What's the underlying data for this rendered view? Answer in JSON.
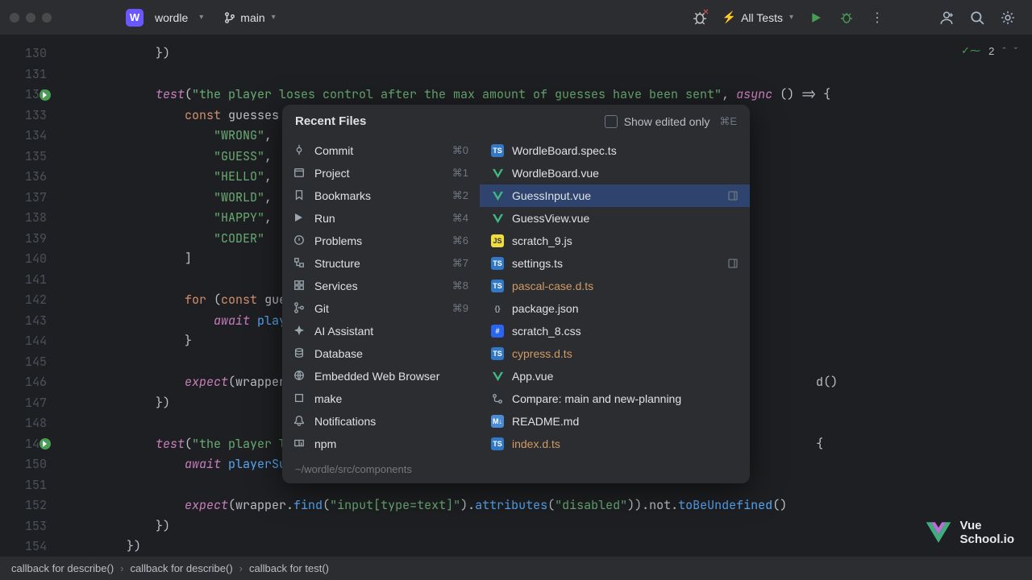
{
  "titlebar": {
    "project_badge": "W",
    "project_name": "wordle",
    "branch": "main",
    "run_config": "All Tests"
  },
  "inspections": {
    "count": "2"
  },
  "gutter": {
    "start": 130,
    "end": 154,
    "run_markers": [
      132,
      149
    ]
  },
  "code_lines": [
    {
      "n": 130,
      "segs": [
        {
          "t": "            })",
          "c": "op"
        }
      ]
    },
    {
      "n": 131,
      "segs": []
    },
    {
      "n": 132,
      "segs": [
        {
          "t": "            ",
          "c": "op"
        },
        {
          "t": "test",
          "c": "fn"
        },
        {
          "t": "(",
          "c": "op"
        },
        {
          "t": "\"the player loses control after the max amount of guesses have been sent\"",
          "c": "str"
        },
        {
          "t": ", ",
          "c": "op"
        },
        {
          "t": "async",
          "c": "fn"
        },
        {
          "t": " () ",
          "c": "op"
        },
        {
          "t": "=>",
          "c": "op"
        },
        {
          "t": " {",
          "c": "op"
        }
      ]
    },
    {
      "n": 133,
      "segs": [
        {
          "t": "                ",
          "c": "op"
        },
        {
          "t": "const",
          "c": "kw"
        },
        {
          "t": " guesses = ",
          "c": "op"
        }
      ]
    },
    {
      "n": 134,
      "segs": [
        {
          "t": "                    ",
          "c": "op"
        },
        {
          "t": "\"WRONG\"",
          "c": "str"
        },
        {
          "t": ",",
          "c": "op"
        }
      ]
    },
    {
      "n": 135,
      "segs": [
        {
          "t": "                    ",
          "c": "op"
        },
        {
          "t": "\"GUESS\"",
          "c": "str"
        },
        {
          "t": ",",
          "c": "op"
        }
      ]
    },
    {
      "n": 136,
      "segs": [
        {
          "t": "                    ",
          "c": "op"
        },
        {
          "t": "\"HELLO\"",
          "c": "str"
        },
        {
          "t": ",",
          "c": "op"
        }
      ]
    },
    {
      "n": 137,
      "segs": [
        {
          "t": "                    ",
          "c": "op"
        },
        {
          "t": "\"WORLD\"",
          "c": "str"
        },
        {
          "t": ",",
          "c": "op"
        }
      ]
    },
    {
      "n": 138,
      "segs": [
        {
          "t": "                    ",
          "c": "op"
        },
        {
          "t": "\"HAPPY\"",
          "c": "str"
        },
        {
          "t": ",",
          "c": "op"
        }
      ]
    },
    {
      "n": 139,
      "segs": [
        {
          "t": "                    ",
          "c": "op"
        },
        {
          "t": "\"CODER\"",
          "c": "str"
        }
      ]
    },
    {
      "n": 140,
      "segs": [
        {
          "t": "                ]",
          "c": "op"
        }
      ]
    },
    {
      "n": 141,
      "segs": []
    },
    {
      "n": 142,
      "segs": [
        {
          "t": "                ",
          "c": "op"
        },
        {
          "t": "for",
          "c": "kw"
        },
        {
          "t": " (",
          "c": "op"
        },
        {
          "t": "const",
          "c": "kw"
        },
        {
          "t": " guess",
          "c": "op"
        }
      ]
    },
    {
      "n": 143,
      "segs": [
        {
          "t": "                    ",
          "c": "op"
        },
        {
          "t": "await",
          "c": "fn"
        },
        {
          "t": " ",
          "c": "op"
        },
        {
          "t": "player",
          "c": "meth"
        }
      ]
    },
    {
      "n": 144,
      "segs": [
        {
          "t": "                }",
          "c": "op"
        }
      ]
    },
    {
      "n": 145,
      "segs": []
    },
    {
      "n": 146,
      "segs": [
        {
          "t": "                ",
          "c": "op"
        },
        {
          "t": "expect",
          "c": "fn"
        },
        {
          "t": "(wrapper.f",
          "c": "op"
        },
        {
          "t": "                                                                       d",
          "c": "op"
        },
        {
          "t": "()",
          "c": "op"
        }
      ]
    },
    {
      "n": 147,
      "segs": [
        {
          "t": "            })",
          "c": "op"
        }
      ]
    },
    {
      "n": 148,
      "segs": []
    },
    {
      "n": 149,
      "segs": [
        {
          "t": "            ",
          "c": "op"
        },
        {
          "t": "test",
          "c": "fn"
        },
        {
          "t": "(",
          "c": "op"
        },
        {
          "t": "\"the player los",
          "c": "str"
        },
        {
          "t": "                                                                       ",
          "c": "op"
        },
        {
          "t": "{",
          "c": "op"
        }
      ]
    },
    {
      "n": 150,
      "segs": [
        {
          "t": "                ",
          "c": "op"
        },
        {
          "t": "await",
          "c": "fn"
        },
        {
          "t": " ",
          "c": "op"
        },
        {
          "t": "playerSubm",
          "c": "meth"
        }
      ]
    },
    {
      "n": 151,
      "segs": []
    },
    {
      "n": 152,
      "segs": [
        {
          "t": "                ",
          "c": "op"
        },
        {
          "t": "expect",
          "c": "fn"
        },
        {
          "t": "(wrapper.",
          "c": "op"
        },
        {
          "t": "find",
          "c": "meth"
        },
        {
          "t": "(",
          "c": "op"
        },
        {
          "t": "\"input[type=text]\"",
          "c": "str"
        },
        {
          "t": ").",
          "c": "op"
        },
        {
          "t": "attributes",
          "c": "meth"
        },
        {
          "t": "(",
          "c": "op"
        },
        {
          "t": "\"disabled\"",
          "c": "str"
        },
        {
          "t": ")).not.",
          "c": "op"
        },
        {
          "t": "toBeUndefined",
          "c": "meth"
        },
        {
          "t": "()",
          "c": "op"
        }
      ]
    },
    {
      "n": 153,
      "segs": [
        {
          "t": "            })",
          "c": "op"
        }
      ]
    },
    {
      "n": 154,
      "segs": [
        {
          "t": "        })",
          "c": "op"
        }
      ]
    }
  ],
  "popup": {
    "title": "Recent Files",
    "show_edited_label": "Show edited only",
    "show_edited_shortcut": "⌘E",
    "path": "~/wordle/src/components",
    "left": [
      {
        "icon": "commit",
        "label": "Commit",
        "sc": "⌘0"
      },
      {
        "icon": "project",
        "label": "Project",
        "sc": "⌘1"
      },
      {
        "icon": "bookmark",
        "label": "Bookmarks",
        "sc": "⌘2"
      },
      {
        "icon": "run",
        "label": "Run",
        "sc": "⌘4"
      },
      {
        "icon": "problems",
        "label": "Problems",
        "sc": "⌘6"
      },
      {
        "icon": "structure",
        "label": "Structure",
        "sc": "⌘7"
      },
      {
        "icon": "services",
        "label": "Services",
        "sc": "⌘8"
      },
      {
        "icon": "git",
        "label": "Git",
        "sc": "⌘9"
      },
      {
        "icon": "ai",
        "label": "AI Assistant",
        "sc": ""
      },
      {
        "icon": "db",
        "label": "Database",
        "sc": ""
      },
      {
        "icon": "browser",
        "label": "Embedded Web Browser",
        "sc": ""
      },
      {
        "icon": "make",
        "label": "make",
        "sc": ""
      },
      {
        "icon": "notif",
        "label": "Notifications",
        "sc": ""
      },
      {
        "icon": "npm",
        "label": "npm",
        "sc": ""
      }
    ],
    "right": [
      {
        "type": "ts",
        "label": "WordleBoard.spec.ts",
        "selected": false,
        "pin": false,
        "dirty": false
      },
      {
        "type": "vue",
        "label": "WordleBoard.vue",
        "selected": false,
        "pin": false,
        "dirty": false
      },
      {
        "type": "vue",
        "label": "GuessInput.vue",
        "selected": true,
        "pin": true,
        "dirty": false
      },
      {
        "type": "vue",
        "label": "GuessView.vue",
        "selected": false,
        "pin": false,
        "dirty": false
      },
      {
        "type": "js",
        "label": "scratch_9.js",
        "selected": false,
        "pin": false,
        "dirty": false
      },
      {
        "type": "ts",
        "label": "settings.ts",
        "selected": false,
        "pin": true,
        "dirty": false
      },
      {
        "type": "ts",
        "label": "pascal-case.d.ts",
        "selected": false,
        "pin": false,
        "dirty": true
      },
      {
        "type": "json",
        "label": "package.json",
        "selected": false,
        "pin": false,
        "dirty": false
      },
      {
        "type": "css",
        "label": "scratch_8.css",
        "selected": false,
        "pin": false,
        "dirty": false
      },
      {
        "type": "ts",
        "label": "cypress.d.ts",
        "selected": false,
        "pin": false,
        "dirty": true
      },
      {
        "type": "vue",
        "label": "App.vue",
        "selected": false,
        "pin": false,
        "dirty": false
      },
      {
        "type": "diff",
        "label": "Compare: main and new-planning",
        "selected": false,
        "pin": false,
        "dirty": false
      },
      {
        "type": "md",
        "label": "README.md",
        "selected": false,
        "pin": false,
        "dirty": false
      },
      {
        "type": "ts",
        "label": "index.d.ts",
        "selected": false,
        "pin": false,
        "dirty": true
      }
    ]
  },
  "breadcrumbs": [
    "callback for describe()",
    "callback for describe()",
    "callback for test()"
  ],
  "watermark": {
    "line1": "Vue",
    "line2": "School.io"
  }
}
